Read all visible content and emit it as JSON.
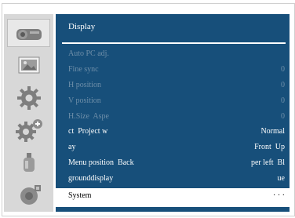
{
  "menu": {
    "title": "Display",
    "rows": [
      {
        "label": "Auto PC adj.",
        "value": ""
      },
      {
        "label": "Fine sync",
        "value": "0"
      },
      {
        "label": "H position",
        "value": "0"
      },
      {
        "label": "V position",
        "value": "0"
      },
      {
        "label": "H.Size  Aspe",
        "value": "0"
      },
      {
        "label": "ct  Project w",
        "value": "Normal"
      },
      {
        "label": "ay",
        "value": "Front  Up"
      },
      {
        "label": "Menu position  Back",
        "value": "per left  Bl"
      },
      {
        "label": "grounddisplay",
        "value": "ue"
      },
      {
        "label": "System",
        "value": "· · ·"
      }
    ]
  },
  "sidebar": {
    "items": [
      {
        "icon": "projector-icon"
      },
      {
        "icon": "picture-icon"
      },
      {
        "icon": "gear-icon"
      },
      {
        "icon": "settings-plus-icon"
      },
      {
        "icon": "bottle-icon"
      },
      {
        "icon": "network-icon"
      }
    ]
  },
  "colors": {
    "panel": "#174f7a",
    "disabled_text": "#6f8fa9",
    "enabled_text": "#ffffff",
    "selected_background": "#ffffff"
  }
}
